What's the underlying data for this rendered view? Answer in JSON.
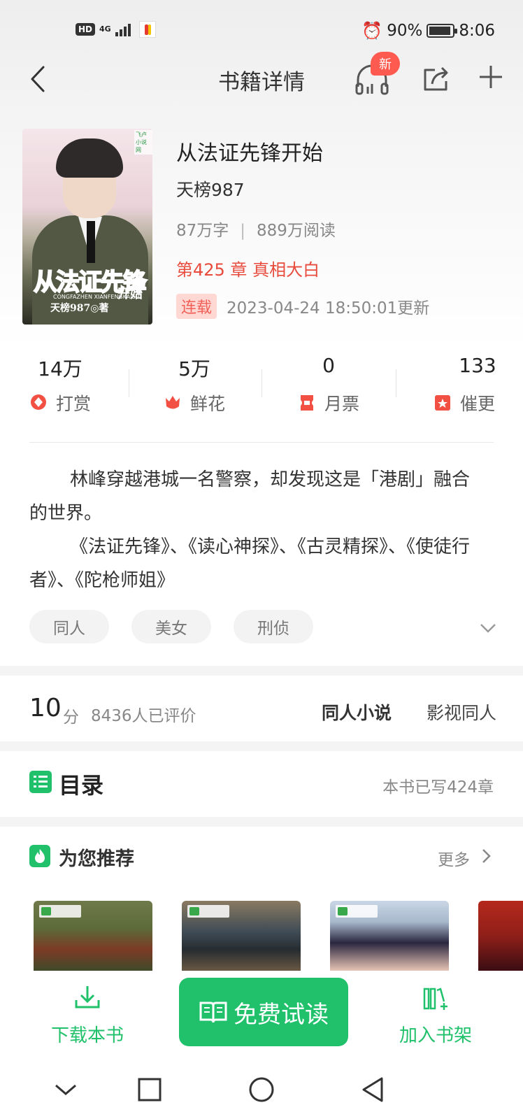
{
  "status_bar": {
    "hd": "HD",
    "network": "4G",
    "battery": "90%",
    "time": "8:06",
    "icons": [
      "signal-icon",
      "app-notification-icon",
      "alarm-icon",
      "battery-icon"
    ]
  },
  "header": {
    "title": "书籍详情",
    "new_badge": "新",
    "icons": [
      "back-arrow-icon",
      "headphones-icon",
      "share-icon",
      "plus-icon"
    ]
  },
  "book": {
    "cover": {
      "title": "从法证先锋",
      "subtitle": "开始",
      "pinyin": "CONGFAZHEN XIANFENGKAISHI",
      "author": "天榜987◎著"
    },
    "title": "从法证先锋开始",
    "author": "天榜987",
    "word_count": "87万字",
    "separator": "|",
    "reads": "889万阅读",
    "latest_chapter": "第425 章 真相大白",
    "status_badge": "连载",
    "update_time": "2023-04-24 18:50:01更新"
  },
  "stats": [
    {
      "value": "14万",
      "label": "打赏",
      "icon": "reward-icon"
    },
    {
      "value": "5万",
      "label": "鲜花",
      "icon": "flower-icon"
    },
    {
      "value": "0",
      "label": "月票",
      "icon": "ticket-icon"
    },
    {
      "value": "133",
      "label": "催更",
      "icon": "urge-icon"
    }
  ],
  "synopsis": {
    "para1": "林峰穿越港城一名警察，却发现这是「港剧」融合的世界。",
    "para2": "《法证先锋》、《读心神探》、《古灵精探》、《使徒行者》、《陀枪师姐》"
  },
  "tags": [
    "同人",
    "美女",
    "刑侦"
  ],
  "rating": {
    "score": "10",
    "unit": "分",
    "count": "8436人已评价",
    "categories": [
      "同人小说",
      "影视同人"
    ]
  },
  "catalog": {
    "title": "目录",
    "count": "本书已写424章"
  },
  "recommend": {
    "title": "为您推荐",
    "more": "更多",
    "books": [
      {
        "colors": [
          "#5c6a3a",
          "#7c3a25"
        ]
      },
      {
        "colors": [
          "#3e4b55",
          "#8a7a62"
        ]
      },
      {
        "colors": [
          "#c9d6e6",
          "#2a2640"
        ]
      },
      {
        "colors": [
          "#b5281c",
          "#3b0d12"
        ]
      }
    ]
  },
  "bottom_bar": {
    "download": "下载本书",
    "read": "免费试读",
    "add_shelf": "加入书架"
  },
  "colors": {
    "accent": "#21c16c",
    "red": "#e84a3c",
    "badge_bg": "#ffd7d3"
  }
}
